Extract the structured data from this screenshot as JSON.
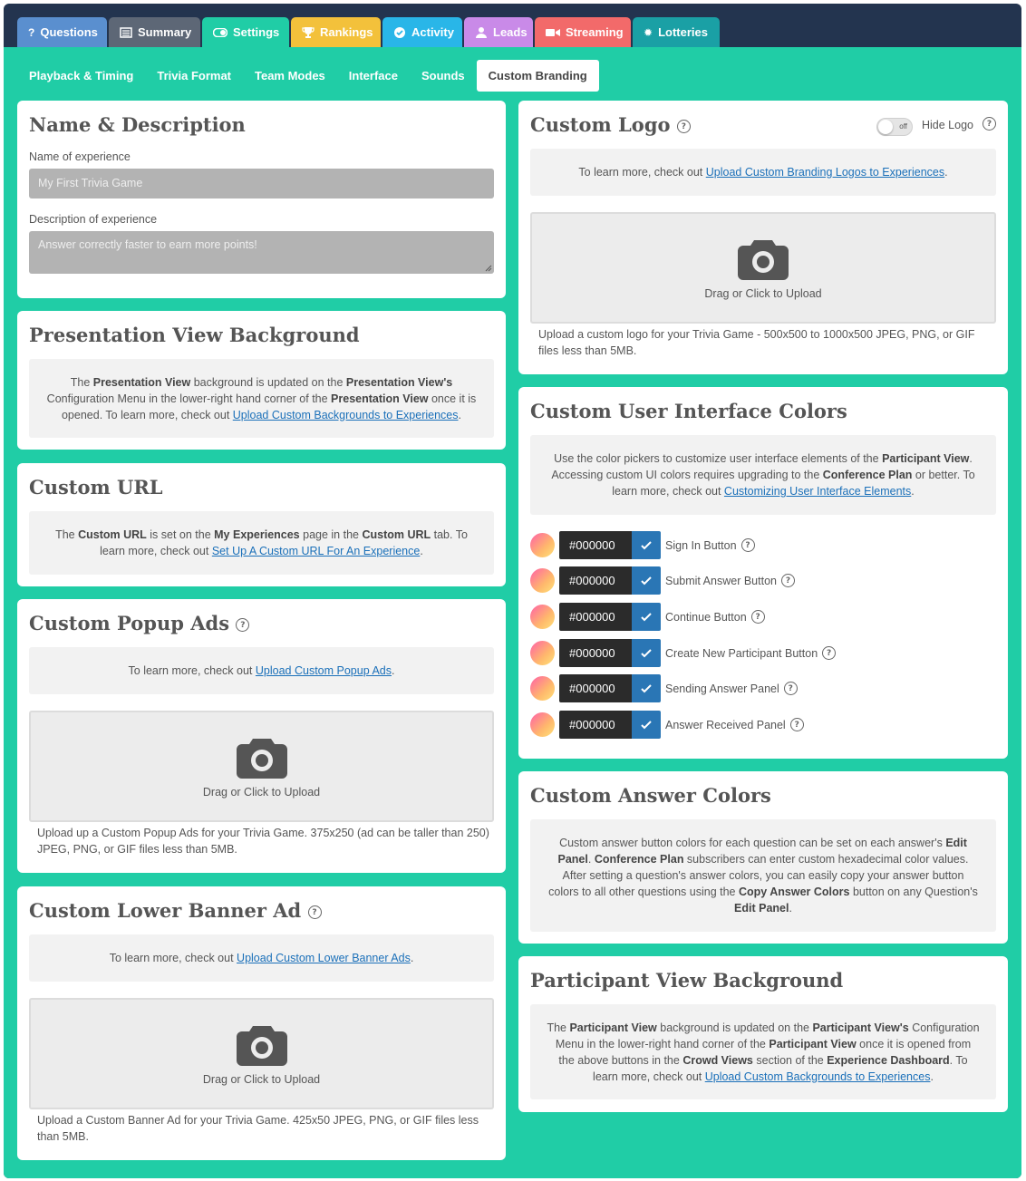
{
  "tabs": [
    {
      "label": "Questions",
      "icon": "question-icon",
      "color": "#5a8fcf"
    },
    {
      "label": "Summary",
      "icon": "list-icon",
      "color": "#5d6776"
    },
    {
      "label": "Settings",
      "icon": "toggle-icon",
      "color": "#20cda6"
    },
    {
      "label": "Rankings",
      "icon": "trophy-icon",
      "color": "#f3c13b"
    },
    {
      "label": "Activity",
      "icon": "check-circle-icon",
      "color": "#29b6e8"
    },
    {
      "label": "Leads",
      "icon": "user-icon",
      "color": "#c98ae8"
    },
    {
      "label": "Streaming",
      "icon": "video-icon",
      "color": "#f26a6a"
    },
    {
      "label": "Lotteries",
      "icon": "gear-icon",
      "color": "#1aa0a5"
    }
  ],
  "subtabs": [
    "Playback & Timing",
    "Trivia Format",
    "Team Modes",
    "Interface",
    "Sounds",
    "Custom Branding"
  ],
  "name_desc": {
    "title": "Name & Description",
    "name_label": "Name of experience",
    "name_value": "My First Trivia Game",
    "desc_label": "Description of experience",
    "desc_value": "Answer correctly faster to earn more points!"
  },
  "presentation_bg": {
    "title": "Presentation View Background",
    "t1": "The ",
    "b1": "Presentation View",
    "t2": " background is updated on the ",
    "b2": "Presentation View's",
    "t3": " Configuration Menu in the lower-right hand corner of the ",
    "b3": "Presentation View",
    "t4": " once it is opened. To learn more, check out ",
    "link": "Upload Custom Backgrounds to Experiences",
    "t5": "."
  },
  "custom_url": {
    "title": "Custom URL",
    "t1": "The ",
    "b1": "Custom URL",
    "t2": " is set on the ",
    "b2": "My Experiences",
    "t3": " page in the ",
    "b3": "Custom URL",
    "t4": " tab. To learn more, check out ",
    "link": "Set Up A Custom URL For An Experience",
    "t5": "."
  },
  "popup_ads": {
    "title": "Custom Popup Ads",
    "info_text": "To learn more, check out ",
    "link": "Upload Custom Popup Ads",
    "period": ".",
    "upload_label": "Drag or Click to Upload",
    "desc": "Upload up a Custom Popup Ads for your Trivia Game. 375x250 (ad can be taller than 250) JPEG, PNG, or GIF files less than 5MB."
  },
  "lower_banner": {
    "title": "Custom Lower Banner Ad",
    "info_text": "To learn more, check out ",
    "link": "Upload Custom Lower Banner Ads",
    "period": ".",
    "upload_label": "Drag or Click to Upload",
    "desc": "Upload a Custom Banner Ad for your Trivia Game. 425x50 JPEG, PNG, or GIF files less than 5MB."
  },
  "custom_logo": {
    "title": "Custom Logo",
    "toggle_text": "off",
    "hide_label": "Hide Logo",
    "info_text": "To learn more, check out ",
    "link": "Upload Custom Branding Logos to Experiences",
    "period": ".",
    "upload_label": "Drag or Click to Upload",
    "desc": "Upload a custom logo for your Trivia Game - 500x500 to 1000x500 JPEG, PNG, or GIF files less than 5MB."
  },
  "ui_colors": {
    "title": "Custom User Interface Colors",
    "t1": "Use the color pickers to customize user interface elements of the ",
    "b1": "Participant View",
    "t2": ". Accessing custom UI colors requires upgrading to the ",
    "b2": "Conference Plan",
    "t3": " or better. To learn more, check out ",
    "link": "Customizing User Interface Elements",
    "t4": ".",
    "rows": [
      {
        "hex": "#000000",
        "label": "Sign In Button"
      },
      {
        "hex": "#000000",
        "label": "Submit Answer Button"
      },
      {
        "hex": "#000000",
        "label": "Continue Button"
      },
      {
        "hex": "#000000",
        "label": "Create New Participant Button"
      },
      {
        "hex": "#000000",
        "label": "Sending Answer Panel"
      },
      {
        "hex": "#000000",
        "label": "Answer Received Panel"
      }
    ]
  },
  "answer_colors": {
    "title": "Custom Answer Colors",
    "t1": "Custom answer button colors for each question can be set on each answer's ",
    "b1": "Edit Panel",
    "t2": ". ",
    "b2": "Conference Plan",
    "t3": " subscribers can enter custom hexadecimal color values. After setting a question's answer colors, you can easily copy your answer button colors to all other questions using the ",
    "b3": "Copy Answer Colors",
    "t4": " button on any Question's ",
    "b4": "Edit Panel",
    "t5": "."
  },
  "participant_bg": {
    "title": "Participant View Background",
    "t1": "The ",
    "b1": "Participant View",
    "t2": " background is updated on the ",
    "b2": "Participant View's",
    "t3": " Configuration Menu in the lower-right hand corner of the ",
    "b3": "Participant View",
    "t4": " once it is opened from the above buttons in the ",
    "b4": "Crowd Views",
    "t5": " section of the ",
    "b5": "Experience Dashboard",
    "t6": ". To learn more, check out ",
    "link": "Upload Custom Backgrounds to Experiences",
    "t7": "."
  },
  "help_glyph": "?"
}
